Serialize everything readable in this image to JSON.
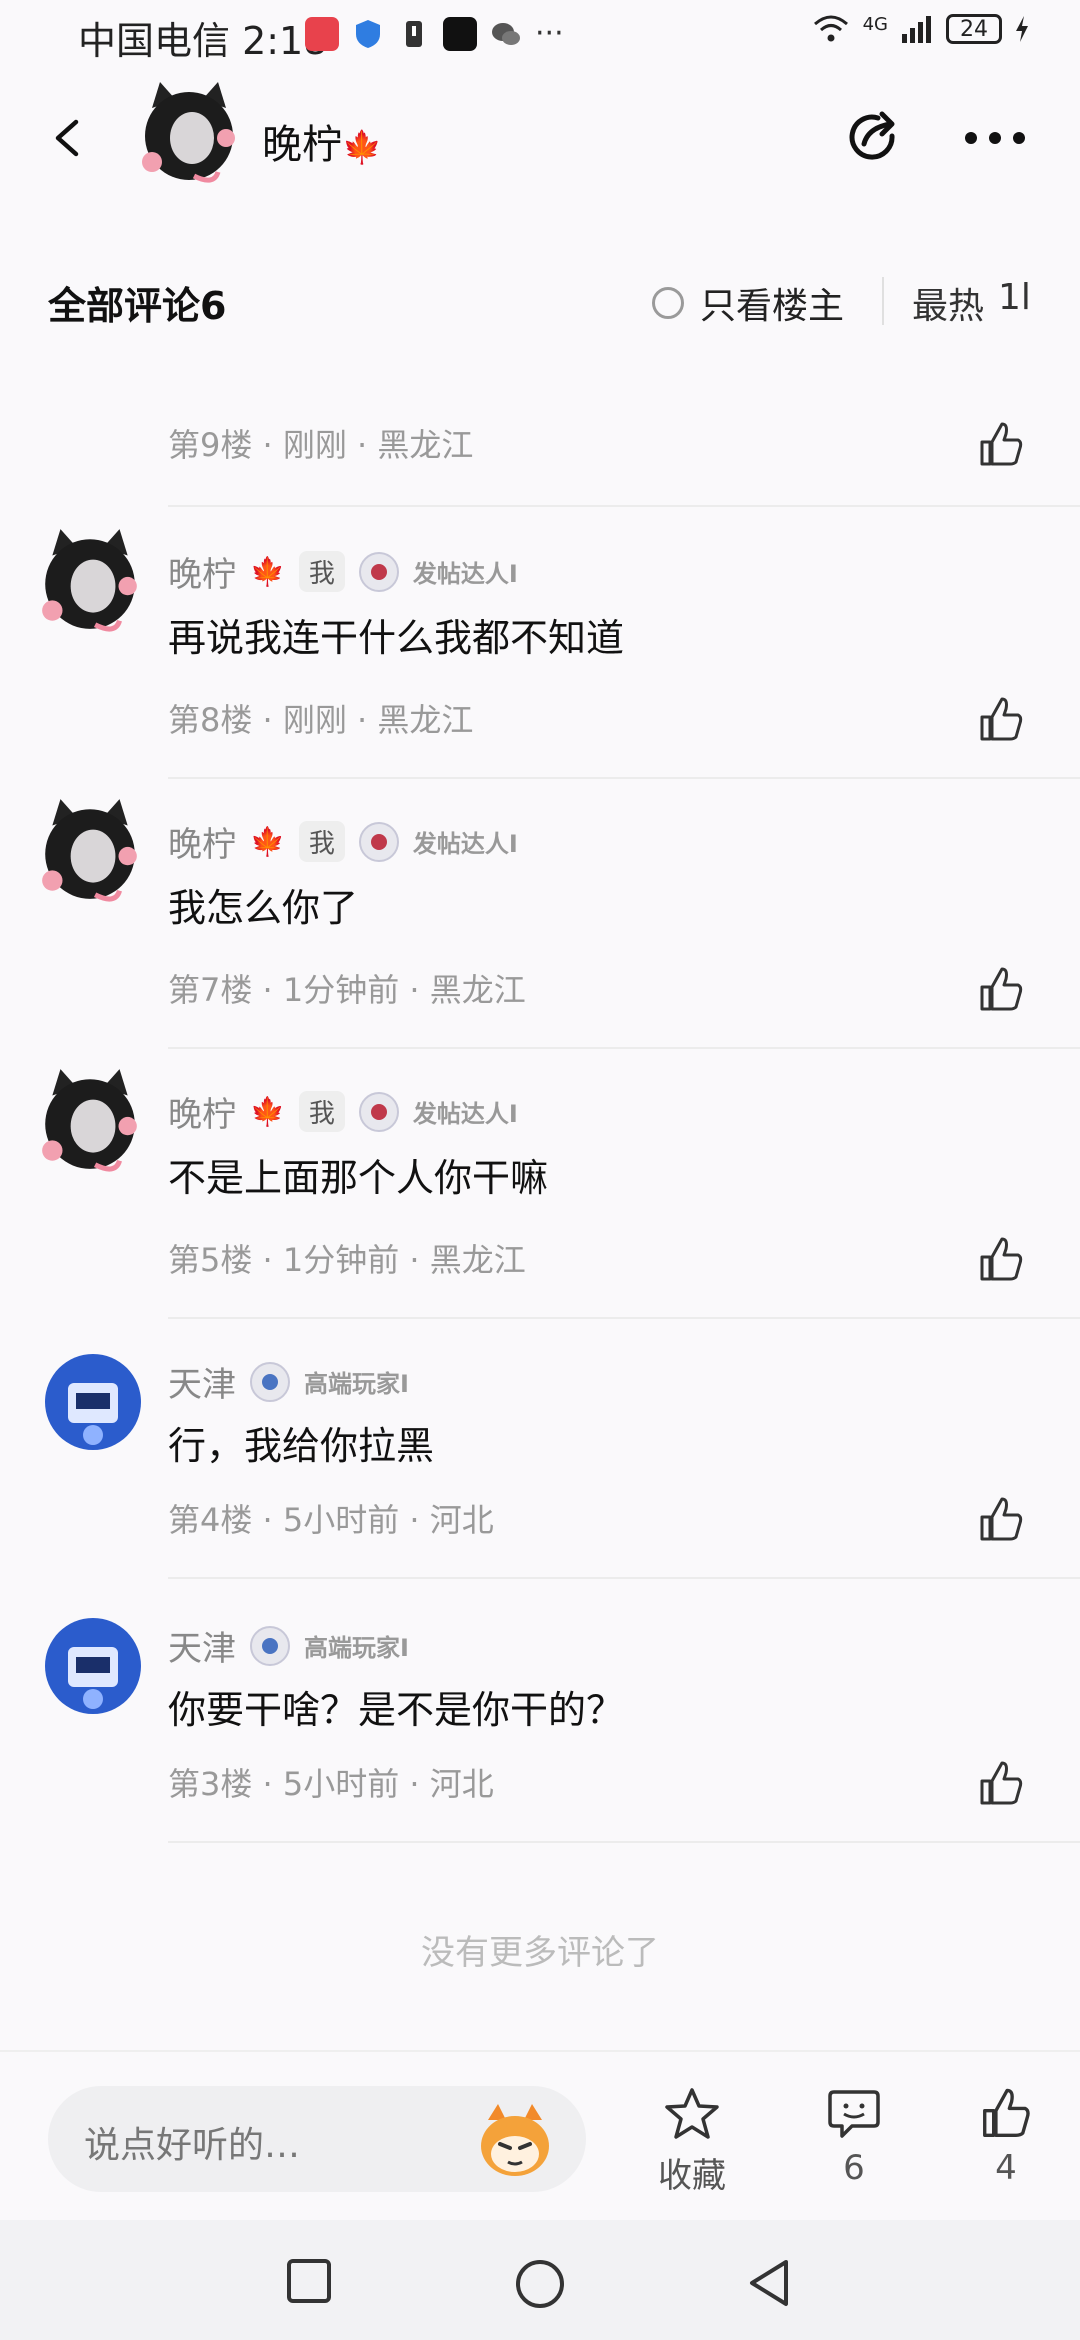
{
  "status_bar": {
    "carrier_time": "中国电信 2:18",
    "network": "4G",
    "battery": "24"
  },
  "header": {
    "name": "晚柠",
    "name_suffix_icon": "maple-leaf-icon"
  },
  "comments_header": {
    "title": "全部评论6",
    "only_op_label": "只看楼主",
    "sort_label": "最热",
    "sort_icon_text": "1l"
  },
  "comments": [
    {
      "has_header": false,
      "meta": "第9楼 · 刚刚 · 黑龙江"
    },
    {
      "has_header": true,
      "name": "晚柠",
      "badge_me": "我",
      "user_title": "发帖达人I",
      "text": "再说我连干什么我都不知道",
      "meta": "第8楼 · 刚刚 · 黑龙江"
    },
    {
      "has_header": true,
      "name": "晚柠",
      "badge_me": "我",
      "user_title": "发帖达人I",
      "text": "我怎么你了",
      "meta": "第7楼 · 1分钟前 · 黑龙江"
    },
    {
      "has_header": true,
      "name": "晚柠",
      "badge_me": "我",
      "user_title": "发帖达人I",
      "text": "不是上面那个人你干嘛",
      "meta": "第5楼 · 1分钟前 · 黑龙江"
    },
    {
      "has_header": true,
      "name": "天津",
      "user_title": "高端玩家I",
      "text": "行，我给你拉黑",
      "meta": "第4楼 · 5小时前 · 河北"
    },
    {
      "has_header": true,
      "name": "天津",
      "user_title": "高端玩家I",
      "text": "你要干啥？是不是你干的？",
      "meta": "第3楼 · 5小时前 · 河北"
    }
  ],
  "no_more_text": "没有更多评论了",
  "bottom_bar": {
    "input_placeholder": "说点好听的…",
    "favorite_label": "收藏",
    "comment_count": "6",
    "like_count": "4"
  },
  "colors": {
    "accent_text": "#111111",
    "muted_text": "#999999",
    "background": "#faf9fb"
  }
}
